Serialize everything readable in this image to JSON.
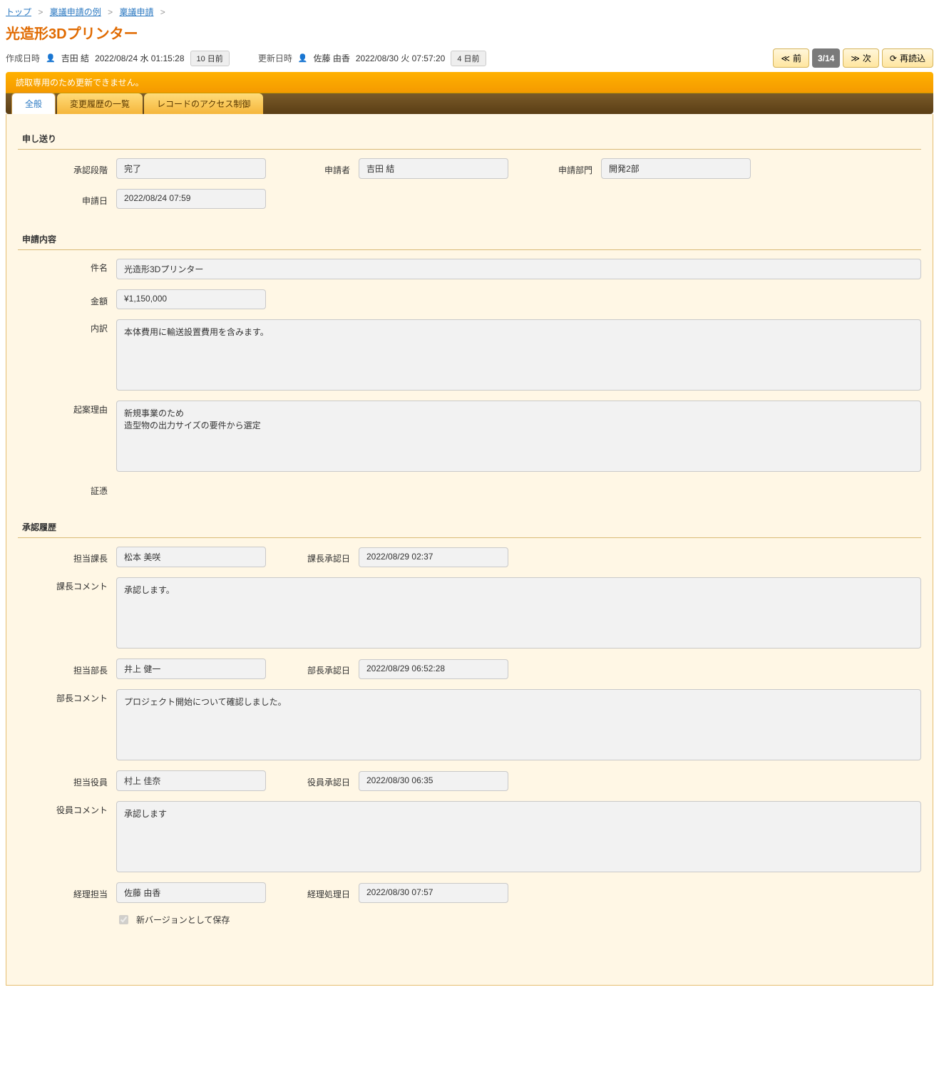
{
  "breadcrumb": {
    "top": "トップ",
    "level1": "稟議申請の例",
    "level2": "稟議申請",
    "sep": ">"
  },
  "page_title": "光造形3Dプリンター",
  "meta": {
    "created": {
      "label": "作成日時",
      "user": "吉田 結",
      "datetime": "2022/08/24 水 01:15:28",
      "badge": "10 日前"
    },
    "updated": {
      "label": "更新日時",
      "user": "佐藤 由香",
      "datetime": "2022/08/30 火 07:57:20",
      "badge": "4 日前"
    }
  },
  "nav": {
    "prev": "前",
    "next": "次",
    "reload": "再読込",
    "counter": "3/14",
    "prev_fast": "≪",
    "next_fast": "≫",
    "reload_icon": "⟳"
  },
  "readonly_msg": "読取専用のため更新できません。",
  "tabs": {
    "general": "全般",
    "history": "変更履歴の一覧",
    "access": "レコードのアクセス制御"
  },
  "sections": {
    "s1": {
      "title": "申し送り",
      "fields": {
        "stage": {
          "label": "承認段階",
          "value": "完了"
        },
        "applicant": {
          "label": "申請者",
          "value": "吉田 結"
        },
        "dept": {
          "label": "申請部門",
          "value": "開発2部"
        },
        "date": {
          "label": "申請日",
          "value": "2022/08/24 07:59"
        }
      }
    },
    "s2": {
      "title": "申請内容",
      "fields": {
        "subject": {
          "label": "件名",
          "value": "光造形3Dプリンター"
        },
        "amount": {
          "label": "金額",
          "value": "¥1,150,000"
        },
        "breakdown": {
          "label": "内訳",
          "value": "本体費用に輸送設置費用を含みます。"
        },
        "reason": {
          "label": "起案理由",
          "value": "新規事業のため\n造型物の出力サイズの要件から選定"
        },
        "evidence": {
          "label": "証憑",
          "value": ""
        }
      }
    },
    "s3": {
      "title": "承認履歴",
      "fields": {
        "mgr": {
          "label": "担当課長",
          "value": "松本 美咲"
        },
        "mgr_date": {
          "label": "課長承認日",
          "value": "2022/08/29 02:37"
        },
        "mgr_comment": {
          "label": "課長コメント",
          "value": "承認します。"
        },
        "dir": {
          "label": "担当部長",
          "value": "井上 健一"
        },
        "dir_date": {
          "label": "部長承認日",
          "value": "2022/08/29 06:52:28"
        },
        "dir_comment": {
          "label": "部長コメント",
          "value": "プロジェクト開始について確認しました。"
        },
        "exec": {
          "label": "担当役員",
          "value": "村上 佳奈"
        },
        "exec_date": {
          "label": "役員承認日",
          "value": "2022/08/30 06:35"
        },
        "exec_comment": {
          "label": "役員コメント",
          "value": "承認します"
        },
        "acct": {
          "label": "経理担当",
          "value": "佐藤 由香"
        },
        "acct_date": {
          "label": "経理処理日",
          "value": "2022/08/30 07:57"
        }
      },
      "save_new_version": "新バージョンとして保存"
    }
  }
}
